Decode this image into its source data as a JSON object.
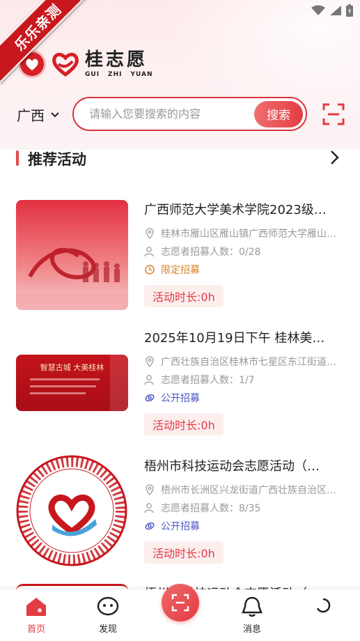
{
  "ribbon": {
    "text": "乐乐亲测"
  },
  "logo": {
    "name": "桂志愿",
    "pinyin": [
      "GUI",
      "ZHI",
      "YUAN"
    ]
  },
  "search": {
    "region": "广西",
    "placeholder": "请输入您要搜索的内容",
    "button": "搜索"
  },
  "section": {
    "title": "推荐活动"
  },
  "activities": [
    {
      "title": "广西师范大学美术学院2023级…",
      "location": "桂林市雁山区雁山镇广西师范大学雁山…",
      "recruit": "志愿者招募人数：0/28",
      "type": "限定招募",
      "duration": "活动时长:0h"
    },
    {
      "title": "2025年10月19日下午 桂林美…",
      "location": "广西壮族自治区桂林市七星区东江街道…",
      "recruit": "志愿者招募人数：1/7",
      "type": "公开招募",
      "duration": "活动时长:0h",
      "banner_line1": "智慧古城  大美桂林"
    },
    {
      "title": "梧州市科技运动会志愿活动（…",
      "location": "梧州市长洲区兴龙街道广西壮族自治区…",
      "recruit": "志愿者招募人数：8/35",
      "type": "公开招募",
      "duration": "活动时长:0h"
    },
    {
      "title": "梧州市科技运动会志愿活动（…"
    }
  ],
  "nav": {
    "items": [
      {
        "label": "首页"
      },
      {
        "label": "发现"
      },
      {
        "label": ""
      },
      {
        "label": "消息"
      },
      {
        "label": ""
      }
    ]
  },
  "colors": {
    "brand": "#e23b42",
    "public": "#4a56c7",
    "limited": "#d9842b"
  }
}
